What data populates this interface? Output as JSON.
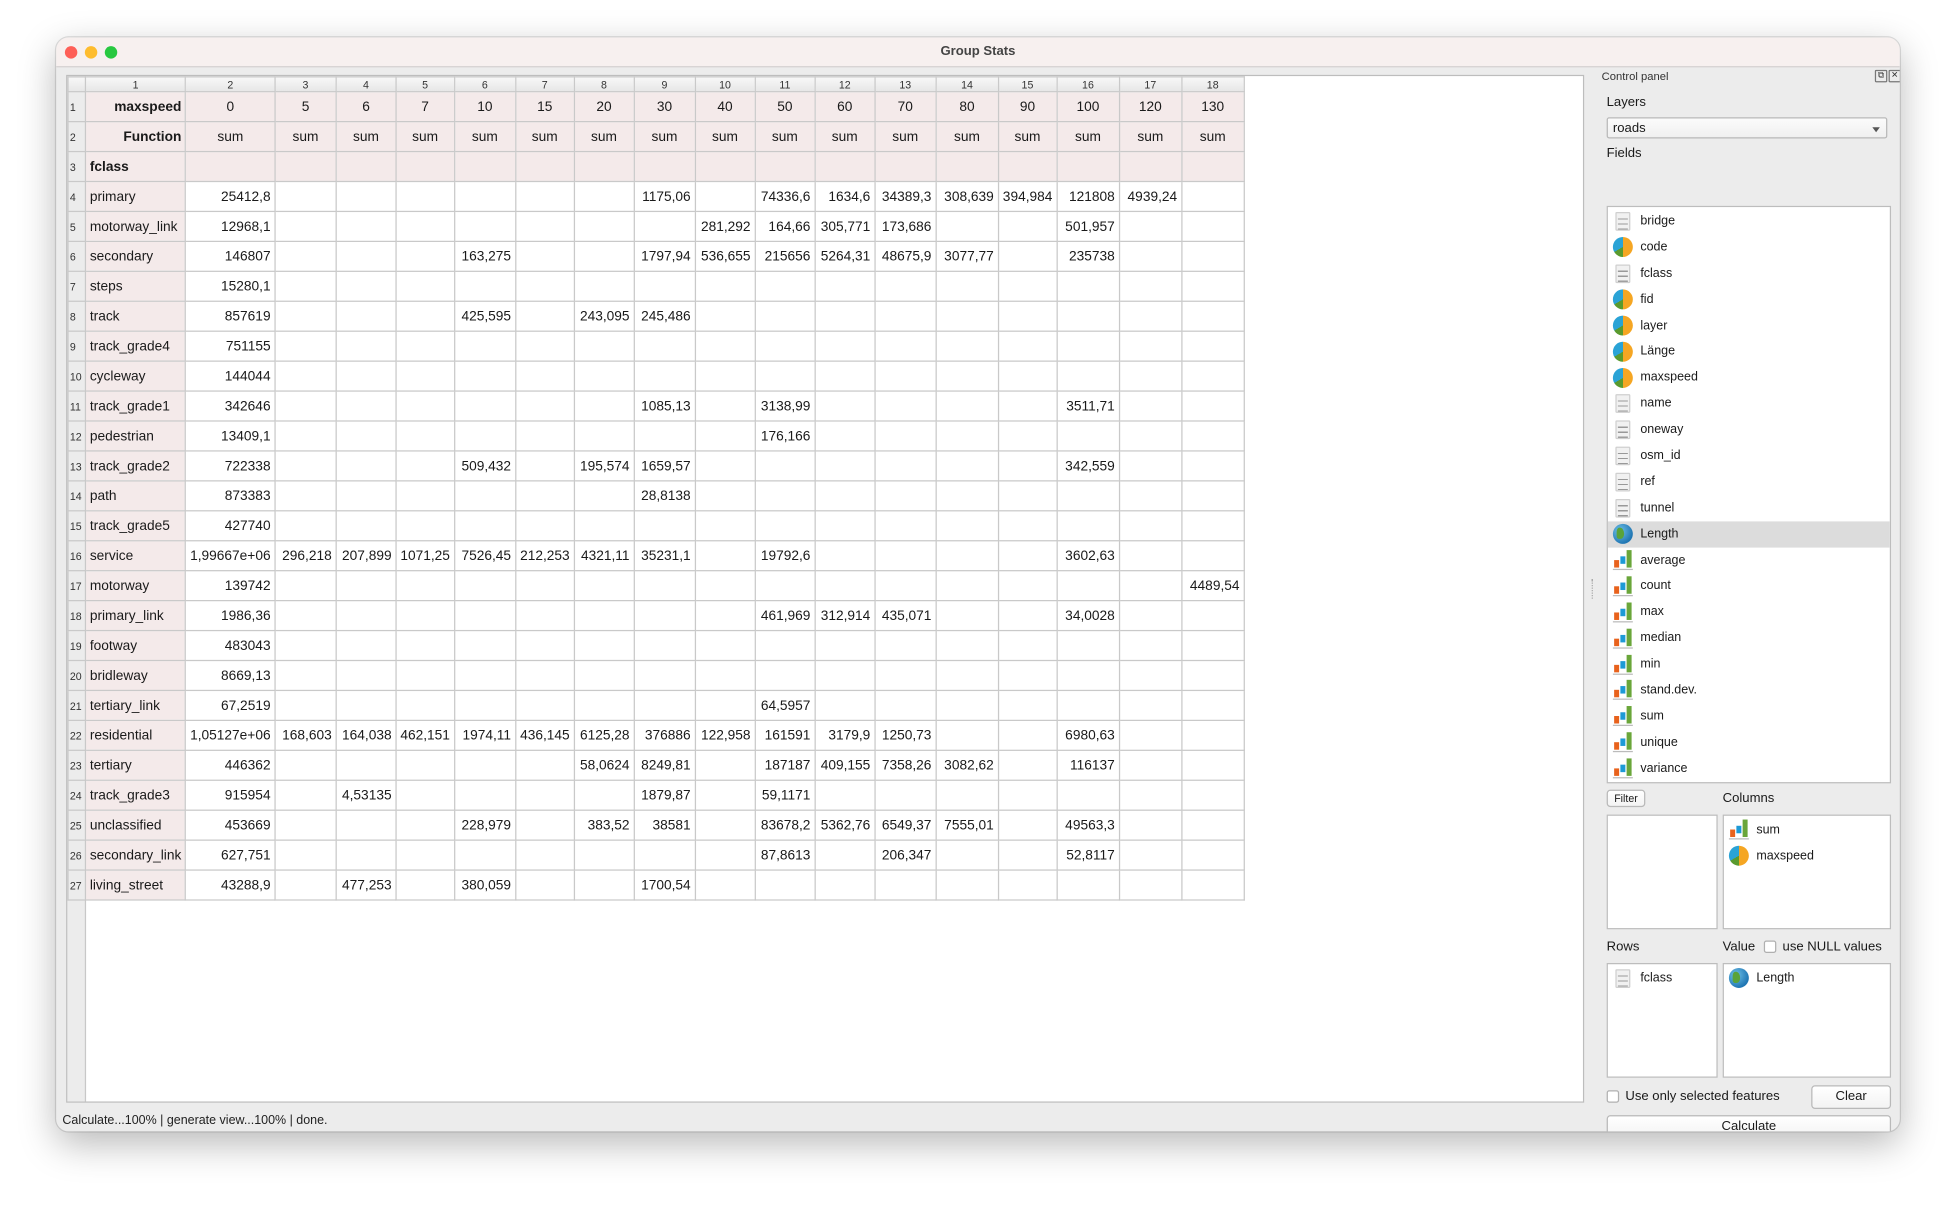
{
  "window": {
    "title": "Group Stats"
  },
  "table": {
    "col_numbers": [
      "1",
      "2",
      "3",
      "4",
      "5",
      "6",
      "7",
      "8",
      "9",
      "10",
      "11",
      "12",
      "13",
      "14",
      "15",
      "16",
      "17",
      "18"
    ],
    "column_field_label": "maxspeed",
    "function_label": "Function",
    "row_field_label": "fclass",
    "maxspeed_values": [
      "0",
      "5",
      "6",
      "7",
      "10",
      "15",
      "20",
      "30",
      "40",
      "50",
      "60",
      "70",
      "80",
      "90",
      "100",
      "120",
      "130"
    ],
    "functions": [
      "sum",
      "sum",
      "sum",
      "sum",
      "sum",
      "sum",
      "sum",
      "sum",
      "sum",
      "sum",
      "sum",
      "sum",
      "sum",
      "sum",
      "sum",
      "sum",
      "sum"
    ],
    "rows": [
      {
        "fclass": "primary",
        "values": [
          "25412,8",
          "",
          "",
          "",
          "",
          "",
          "",
          "1175,06",
          "",
          "74336,6",
          "1634,6",
          "34389,3",
          "308,639",
          "394,984",
          "121808",
          "4939,24",
          ""
        ]
      },
      {
        "fclass": "motorway_link",
        "values": [
          "12968,1",
          "",
          "",
          "",
          "",
          "",
          "",
          "",
          "281,292",
          "164,66",
          "305,771",
          "173,686",
          "",
          "",
          "501,957",
          "",
          ""
        ]
      },
      {
        "fclass": "secondary",
        "values": [
          "146807",
          "",
          "",
          "",
          "163,275",
          "",
          "",
          "1797,94",
          "536,655",
          "215656",
          "5264,31",
          "48675,9",
          "3077,77",
          "",
          "235738",
          "",
          ""
        ]
      },
      {
        "fclass": "steps",
        "values": [
          "15280,1",
          "",
          "",
          "",
          "",
          "",
          "",
          "",
          "",
          "",
          "",
          "",
          "",
          "",
          "",
          "",
          ""
        ]
      },
      {
        "fclass": "track",
        "values": [
          "857619",
          "",
          "",
          "",
          "425,595",
          "",
          "243,095",
          "245,486",
          "",
          "",
          "",
          "",
          "",
          "",
          "",
          "",
          ""
        ]
      },
      {
        "fclass": "track_grade4",
        "values": [
          "751155",
          "",
          "",
          "",
          "",
          "",
          "",
          "",
          "",
          "",
          "",
          "",
          "",
          "",
          "",
          "",
          ""
        ]
      },
      {
        "fclass": "cycleway",
        "values": [
          "144044",
          "",
          "",
          "",
          "",
          "",
          "",
          "",
          "",
          "",
          "",
          "",
          "",
          "",
          "",
          "",
          ""
        ]
      },
      {
        "fclass": "track_grade1",
        "values": [
          "342646",
          "",
          "",
          "",
          "",
          "",
          "",
          "1085,13",
          "",
          "3138,99",
          "",
          "",
          "",
          "",
          "3511,71",
          "",
          ""
        ]
      },
      {
        "fclass": "pedestrian",
        "values": [
          "13409,1",
          "",
          "",
          "",
          "",
          "",
          "",
          "",
          "",
          "176,166",
          "",
          "",
          "",
          "",
          "",
          "",
          ""
        ]
      },
      {
        "fclass": "track_grade2",
        "values": [
          "722338",
          "",
          "",
          "",
          "509,432",
          "",
          "195,574",
          "1659,57",
          "",
          "",
          "",
          "",
          "",
          "",
          "342,559",
          "",
          ""
        ]
      },
      {
        "fclass": "path",
        "values": [
          "873383",
          "",
          "",
          "",
          "",
          "",
          "",
          "28,8138",
          "",
          "",
          "",
          "",
          "",
          "",
          "",
          "",
          ""
        ]
      },
      {
        "fclass": "track_grade5",
        "values": [
          "427740",
          "",
          "",
          "",
          "",
          "",
          "",
          "",
          "",
          "",
          "",
          "",
          "",
          "",
          "",
          "",
          ""
        ]
      },
      {
        "fclass": "service",
        "values": [
          "1,99667e+06",
          "296,218",
          "207,899",
          "1071,25",
          "7526,45",
          "212,253",
          "4321,11",
          "35231,1",
          "",
          "19792,6",
          "",
          "",
          "",
          "",
          "3602,63",
          "",
          ""
        ]
      },
      {
        "fclass": "motorway",
        "values": [
          "139742",
          "",
          "",
          "",
          "",
          "",
          "",
          "",
          "",
          "",
          "",
          "",
          "",
          "",
          "",
          "",
          "4489,54"
        ]
      },
      {
        "fclass": "primary_link",
        "values": [
          "1986,36",
          "",
          "",
          "",
          "",
          "",
          "",
          "",
          "",
          "461,969",
          "312,914",
          "435,071",
          "",
          "",
          "34,0028",
          "",
          ""
        ]
      },
      {
        "fclass": "footway",
        "values": [
          "483043",
          "",
          "",
          "",
          "",
          "",
          "",
          "",
          "",
          "",
          "",
          "",
          "",
          "",
          "",
          "",
          ""
        ]
      },
      {
        "fclass": "bridleway",
        "values": [
          "8669,13",
          "",
          "",
          "",
          "",
          "",
          "",
          "",
          "",
          "",
          "",
          "",
          "",
          "",
          "",
          "",
          ""
        ]
      },
      {
        "fclass": "tertiary_link",
        "values": [
          "67,2519",
          "",
          "",
          "",
          "",
          "",
          "",
          "",
          "",
          "64,5957",
          "",
          "",
          "",
          "",
          "",
          "",
          ""
        ]
      },
      {
        "fclass": "residential",
        "values": [
          "1,05127e+06",
          "168,603",
          "164,038",
          "462,151",
          "1974,11",
          "436,145",
          "6125,28",
          "376886",
          "122,958",
          "161591",
          "3179,9",
          "1250,73",
          "",
          "",
          "6980,63",
          "",
          ""
        ]
      },
      {
        "fclass": "tertiary",
        "values": [
          "446362",
          "",
          "",
          "",
          "",
          "",
          "58,0624",
          "8249,81",
          "",
          "187187",
          "409,155",
          "7358,26",
          "3082,62",
          "",
          "116137",
          "",
          ""
        ]
      },
      {
        "fclass": "track_grade3",
        "values": [
          "915954",
          "",
          "4,53135",
          "",
          "",
          "",
          "",
          "1879,87",
          "",
          "59,1171",
          "",
          "",
          "",
          "",
          "",
          "",
          ""
        ]
      },
      {
        "fclass": "unclassified",
        "values": [
          "453669",
          "",
          "",
          "",
          "228,979",
          "",
          "383,52",
          "38581",
          "",
          "83678,2",
          "5362,76",
          "6549,37",
          "7555,01",
          "",
          "49563,3",
          "",
          ""
        ]
      },
      {
        "fclass": "secondary_link",
        "values": [
          "627,751",
          "",
          "",
          "",
          "",
          "",
          "",
          "",
          "",
          "87,8613",
          "",
          "206,347",
          "",
          "",
          "52,8117",
          "",
          ""
        ]
      },
      {
        "fclass": "living_street",
        "values": [
          "43288,9",
          "",
          "477,253",
          "",
          "380,059",
          "",
          "",
          "1700,54",
          "",
          "",
          "",
          "",
          "",
          "",
          "",
          "",
          ""
        ]
      }
    ]
  },
  "status_bar": {
    "text": "Calculate...100% |  generate view...100% |  done."
  },
  "control_panel": {
    "title": "Control panel",
    "layers_label": "Layers",
    "layer_selected": "roads",
    "fields_label": "Fields",
    "fields": [
      {
        "label": "bridge",
        "icon": "text"
      },
      {
        "label": "code",
        "icon": "pie"
      },
      {
        "label": "fclass",
        "icon": "text"
      },
      {
        "label": "fid",
        "icon": "pie"
      },
      {
        "label": "layer",
        "icon": "pie"
      },
      {
        "label": "Länge",
        "icon": "pie"
      },
      {
        "label": "maxspeed",
        "icon": "pie"
      },
      {
        "label": "name",
        "icon": "text"
      },
      {
        "label": "oneway",
        "icon": "text"
      },
      {
        "label": "osm_id",
        "icon": "text"
      },
      {
        "label": "ref",
        "icon": "text"
      },
      {
        "label": "tunnel",
        "icon": "text"
      },
      {
        "label": "Length",
        "icon": "globe",
        "selected": true
      },
      {
        "label": "average",
        "icon": "bars"
      },
      {
        "label": "count",
        "icon": "bars"
      },
      {
        "label": "max",
        "icon": "bars"
      },
      {
        "label": "median",
        "icon": "bars"
      },
      {
        "label": "min",
        "icon": "bars"
      },
      {
        "label": "stand.dev.",
        "icon": "bars"
      },
      {
        "label": "sum",
        "icon": "bars"
      },
      {
        "label": "unique",
        "icon": "bars"
      },
      {
        "label": "variance",
        "icon": "bars"
      }
    ],
    "filter_button": "Filter",
    "columns_label": "Columns",
    "columns": [
      {
        "label": "sum",
        "icon": "bars"
      },
      {
        "label": "maxspeed",
        "icon": "pie"
      }
    ],
    "rows_label": "Rows",
    "rows": [
      {
        "label": "fclass",
        "icon": "text"
      }
    ],
    "value_label": "Value",
    "use_null_label": "use NULL values",
    "use_null_checked": false,
    "value": [
      {
        "label": "Length",
        "icon": "globe"
      }
    ],
    "use_selected_label": "Use only selected features",
    "use_selected_checked": false,
    "clear_button": "Clear",
    "calculate_button": "Calculate"
  }
}
